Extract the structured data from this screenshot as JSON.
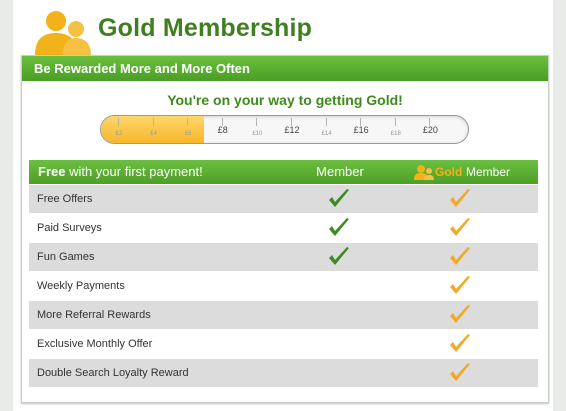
{
  "header": {
    "title": "Gold Membership",
    "icon": "members-group-icon"
  },
  "panel": {
    "title": "Be Rewarded More and More Often"
  },
  "progress": {
    "heading": "You're on your way to getting Gold!",
    "filled_fraction": 0.28,
    "ticks": [
      {
        "label": "£2",
        "major": false
      },
      {
        "label": "£4",
        "major": false
      },
      {
        "label": "£6",
        "major": false
      },
      {
        "label": "£8",
        "major": true
      },
      {
        "label": "£10",
        "major": false
      },
      {
        "label": "£12",
        "major": true
      },
      {
        "label": "£14",
        "major": false
      },
      {
        "label": "£16",
        "major": true
      },
      {
        "label": "£18",
        "major": false
      },
      {
        "label": "£20",
        "major": true
      }
    ]
  },
  "table": {
    "header": {
      "free_bold": "Free",
      "free_rest": " with your first payment!",
      "member": "Member",
      "gold": "Gold",
      "gold_member": "Member"
    },
    "rows": [
      {
        "label": "Free Offers",
        "member": true,
        "gold": true
      },
      {
        "label": "Paid Surveys",
        "member": true,
        "gold": true
      },
      {
        "label": "Fun Games",
        "member": true,
        "gold": true
      },
      {
        "label": "Weekly Payments",
        "member": false,
        "gold": true
      },
      {
        "label": "More Referral Rewards",
        "member": false,
        "gold": true
      },
      {
        "label": "Exclusive Monthly Offer",
        "member": false,
        "gold": true
      },
      {
        "label": "Double Search Loyalty Reward",
        "member": false,
        "gold": true
      }
    ]
  },
  "colors": {
    "green": "#3f7f20",
    "bar_green": "#5cae31",
    "gold": "#f3b21a",
    "member_check": "#3c8b23",
    "gold_check": "#f2a92a"
  }
}
